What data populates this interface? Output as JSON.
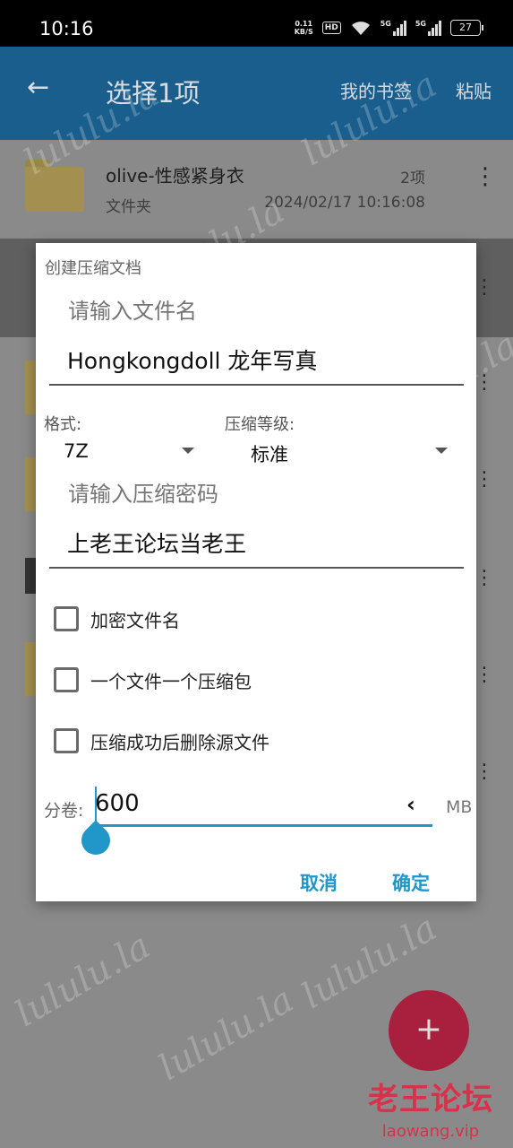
{
  "status_bar": {
    "time": "10:16",
    "net_speed": "0.11",
    "net_unit": "KB/S",
    "hd": "HD",
    "sig1_label": "5G",
    "sig2_label": "5G",
    "battery": "27"
  },
  "app_bar": {
    "title": "选择1项",
    "bookmarks": "我的书签",
    "paste": "粘贴"
  },
  "list": {
    "items": [
      {
        "name": "olive-性感紧身衣",
        "type": "文件夹",
        "count": "2项",
        "date": "2024/02/17 10:16:08"
      }
    ]
  },
  "dialog": {
    "title": "创建压缩文档",
    "filename_hint": "请输入文件名",
    "filename_value": "Hongkongdoll 龙年写真",
    "format_label": "格式:",
    "format_value": "7Z",
    "level_label": "压缩等级:",
    "level_value": "标准",
    "password_hint": "请输入压缩密码",
    "password_value": "上老王论坛当老王",
    "options": [
      {
        "label": "加密文件名",
        "checked": false
      },
      {
        "label": "一个文件一个压缩包",
        "checked": false
      },
      {
        "label": "压缩成功后删除源文件",
        "checked": false
      }
    ],
    "volume_label": "分卷:",
    "volume_value": "600",
    "volume_chevron": "‹",
    "volume_unit": "MB",
    "cancel": "取消",
    "ok": "确定"
  },
  "fab": {
    "icon": "plus-icon",
    "symbol": "+"
  },
  "watermark": {
    "site_cn": "老王论坛",
    "site_url": "laowang.vip",
    "pattern_text": "lululu.la"
  },
  "colors": {
    "accent": "#2196c9",
    "app_bar": "#1a5e8d",
    "fab": "#a8203d",
    "watermark_red": "#d8314a"
  }
}
